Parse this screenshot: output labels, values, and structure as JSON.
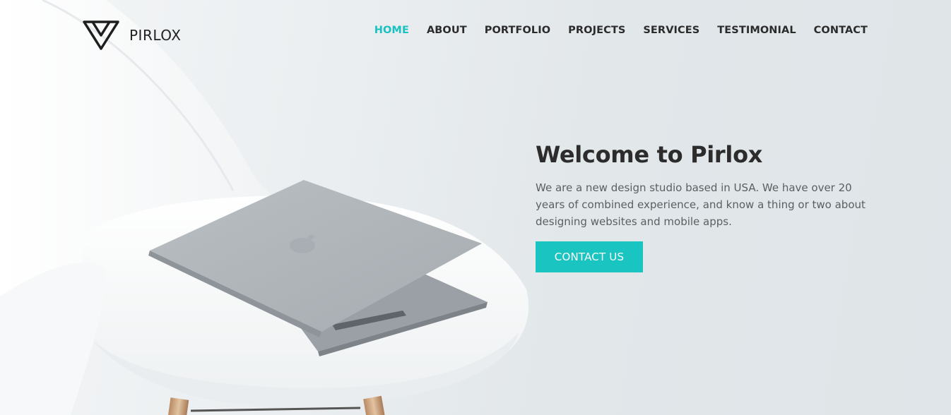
{
  "brand": {
    "name": "PIRLOX",
    "logo_icon": "triangle-logo-icon"
  },
  "nav": {
    "items": [
      {
        "label": "HOME",
        "active": true
      },
      {
        "label": "ABOUT",
        "active": false
      },
      {
        "label": "PORTFOLIO",
        "active": false
      },
      {
        "label": "PROJECTS",
        "active": false
      },
      {
        "label": "SERVICES",
        "active": false
      },
      {
        "label": "TESTIMONIAL",
        "active": false
      },
      {
        "label": "CONTACT",
        "active": false
      }
    ]
  },
  "hero": {
    "title": "Welcome to Pirlox",
    "description": "We are a new design studio based in USA. We have over 20 years of combined experience, and know a thing or two about designing websites and mobile apps.",
    "cta_label": "CONTACT US",
    "image": "laptop-on-white-chair"
  },
  "colors": {
    "accent": "#19c4c1",
    "text_dark": "#2c2c2c",
    "background": "#e3e8eb"
  }
}
